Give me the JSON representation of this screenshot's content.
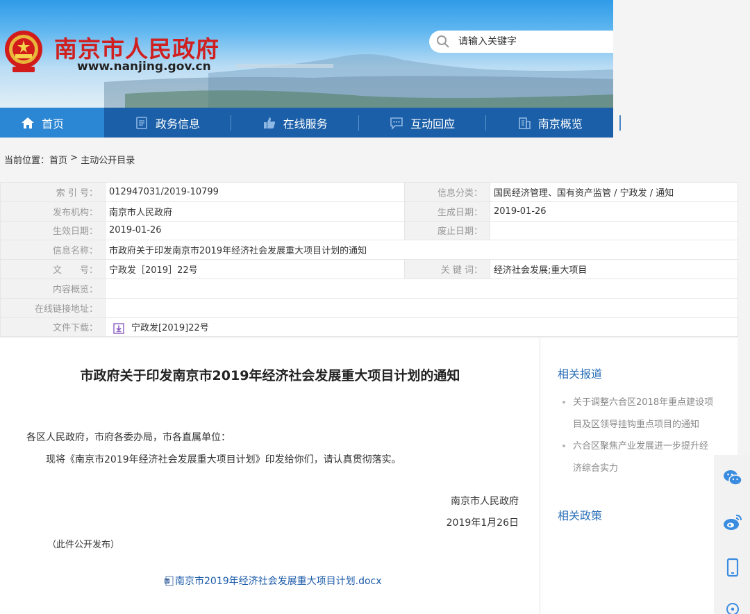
{
  "site": {
    "title": "南京市人民政府",
    "url": "www.nanjing.gov.cn",
    "search_placeholder": "请输入关键字"
  },
  "nav": {
    "items": [
      {
        "label": "首页",
        "icon": "home-icon"
      },
      {
        "label": "政务信息",
        "icon": "document-icon"
      },
      {
        "label": "在线服务",
        "icon": "thumbs-up-icon"
      },
      {
        "label": "互动回应",
        "icon": "chat-icon"
      },
      {
        "label": "南京概览",
        "icon": "building-icon"
      }
    ]
  },
  "breadcrumb": {
    "prefix": "当前位置：",
    "home": "首页",
    "sep": " > ",
    "current": "主动公开目录"
  },
  "info": {
    "index_label": "索 引 号：",
    "index_value": "012947031/2019-10799",
    "category_label": "信息分类：",
    "category_value": "国民经济管理、国有资产监管 / 宁政发 / 通知",
    "publisher_label": "发布机构：",
    "publisher_value": "南京市人民政府",
    "created_label": "生成日期：",
    "created_value": "2019-01-26",
    "effective_label": "生效日期：",
    "effective_value": "2019-01-26",
    "abolished_label": "废止日期：",
    "abolished_value": "",
    "name_label": "信息名称：",
    "name_value": "市政府关于印发南京市2019年经济社会发展重大项目计划的通知",
    "docno_label": "文　　号：",
    "docno_value": "宁政发［2019］22号",
    "keywords_label": "关 键 词：",
    "keywords_value": "经济社会发展;重大项目",
    "summary_label": "内容概览：",
    "summary_value": "",
    "link_label": "在线链接地址：",
    "link_value": "",
    "download_label": "文件下载：",
    "download_value": "宁政发[2019]22号"
  },
  "article": {
    "title": "市政府关于印发南京市2019年经济社会发展重大项目计划的通知",
    "greeting": "各区人民政府，市府各委办局，市各直属单位：",
    "body": "现将《南京市2019年经济社会发展重大项目计划》印发给你们，请认真贯彻落实。",
    "signature": "南京市人民政府",
    "date": "2019年1月26日",
    "note": "（此件公开发布）",
    "attachment": "南京市2019年经济社会发展重大项目计划.docx"
  },
  "sidebar": {
    "reports_heading": "相关报道",
    "reports": [
      "关于调整六合区2018年重点建设项目及区领导挂钩重点项目的通知",
      "六合区聚焦产业发展进一步提升经济综合实力"
    ],
    "policy_heading": "相关政策"
  },
  "share": {
    "icons": [
      "wechat-icon",
      "weibo-icon",
      "mobile-icon",
      "location-icon"
    ]
  },
  "colors": {
    "title_red": "#d01f1f",
    "nav_blue": "#1b5fa8",
    "nav_active": "#2b86d3",
    "link_blue": "#2a6fb8"
  }
}
